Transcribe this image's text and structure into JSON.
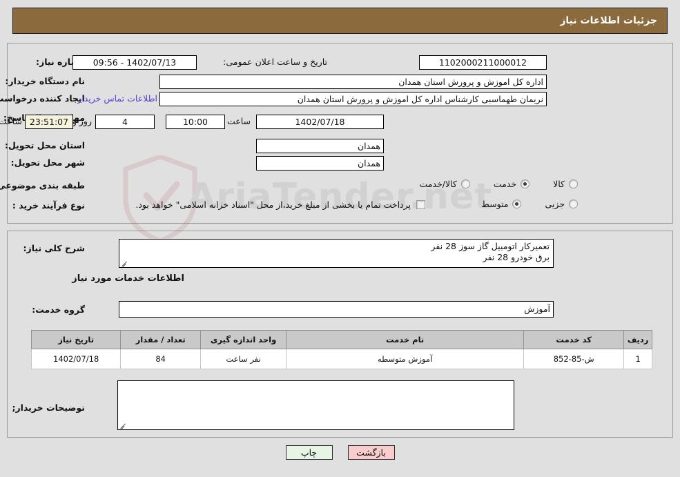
{
  "header": {
    "title": "جزئیات اطلاعات نیاز"
  },
  "form": {
    "need_number_label": "شماره نیاز:",
    "need_number_value": "1102000211000012",
    "public_announce_label": "تاریخ و ساعت اعلان عمومی:",
    "public_announce_value": "1402/07/13 - 09:56",
    "buyer_org_label": "نام دستگاه خریدار:",
    "buyer_org_value": "اداره کل اموزش و پرورش استان همدان",
    "empty_field_value": "",
    "requester_label": "ایجاد کننده درخواست:",
    "requester_value": "نریمان طهماسبی کارشناس اداره کل اموزش و پرورش استان همدان",
    "contact_link": "اطلاعات تماس خریدار",
    "deadline_label": "مهلت ارسال پاسخ: تا تاریخ:",
    "deadline_date": "1402/07/18",
    "hour_label": "ساعت",
    "deadline_time": "10:00",
    "days_remaining": "4",
    "days_word": "روز و",
    "countdown": "23:51:07",
    "countdown_suffix": "ساعت باقی مانده",
    "province_label": "استان محل تحویل:",
    "province_value": "همدان",
    "city_label": "شهر محل تحویل:",
    "city_value": "همدان",
    "classification_label": "طبقه بندی موضوعی:",
    "classification_options": [
      {
        "label": "کالا",
        "selected": false
      },
      {
        "label": "خدمت",
        "selected": true
      },
      {
        "label": "کالا/خدمت",
        "selected": false
      }
    ],
    "purchase_type_label": "نوع فرآیند خرید :",
    "purchase_type_options": [
      {
        "label": "جزیی",
        "selected": false
      },
      {
        "label": "متوسط",
        "selected": true
      }
    ],
    "treasury_checkbox_checked": false,
    "treasury_note": "پرداخت تمام یا بخشی از مبلغ خرید،از محل \"اسناد خزانه اسلامی\" خواهد بود."
  },
  "need_description": {
    "label": "شرح کلی نیاز:",
    "value": "تعمیرکار اتومبیل گاز سوز  28 نفر\nبرق خودرو 28 نفر"
  },
  "services_section": {
    "heading": "اطلاعات خدمات مورد نیاز",
    "service_group_label": "گروه خدمت:",
    "service_group_value": "آموزش"
  },
  "table": {
    "columns": [
      "ردیف",
      "کد خدمت",
      "نام خدمت",
      "واحد اندازه گیری",
      "تعداد / مقدار",
      "تاریخ نیاز"
    ],
    "rows": [
      {
        "row": "1",
        "code": "ش-85-852",
        "name": "آموزش متوسطه",
        "unit": "نفر ساعت",
        "quantity": "84",
        "need_date": "1402/07/18"
      }
    ]
  },
  "buyer_notes": {
    "label": "توضیحات خریدار;",
    "value": ""
  },
  "buttons": {
    "print": "چاپ",
    "back": "بازگشت"
  },
  "watermark": {
    "text": "AriaTender.net"
  },
  "colors": {
    "header_brown": "#8b6b3d",
    "page_background": "#e0e0e0",
    "link_purple": "#5a3fd6",
    "countdown_cream": "#f6f4dc",
    "table_header_gray": "#c9c9c9",
    "button_print_green": "#e6f5e6",
    "button_back_pink": "#f9ccce"
  }
}
